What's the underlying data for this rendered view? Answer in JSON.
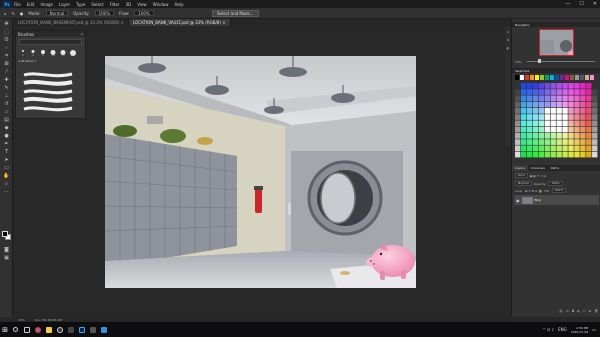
{
  "menubar": {
    "app_logo": "Ps",
    "items": [
      "File",
      "Edit",
      "Image",
      "Layer",
      "Type",
      "Select",
      "Filter",
      "3D",
      "View",
      "Window",
      "Help"
    ]
  },
  "window_controls": {
    "minimize": "—",
    "maximize": "☐",
    "close": "✕"
  },
  "options_bar": {
    "mode_label": "Mode:",
    "mode_value": "Normal",
    "opacity_label": "Opacity:",
    "opacity_value": "100%",
    "flow_label": "Flow:",
    "flow_value": "100%",
    "button_label": "Select and Mask..."
  },
  "tabs": [
    {
      "label": "LOCATION_BANK_BASEMENT.psd @ 33.3% (RGB/8) ×",
      "active": false
    },
    {
      "label": "LOCATION_BANK_VAULT.psd @ 33% (RGB/8) ×",
      "active": true
    }
  ],
  "brush_panel": {
    "title": "Brushes",
    "search_placeholder": "",
    "presets": [
      {
        "num": "1"
      },
      {
        "num": "3"
      },
      {
        "num": "5"
      },
      {
        "num": "10"
      },
      {
        "num": "30"
      },
      {
        "num": "50"
      }
    ],
    "group_label": "▸ Brushes 1"
  },
  "right_panels": {
    "navigator_tab": "Navigator",
    "zoom_value": "33%",
    "swatches_tab": "Swatches",
    "layers_tabs": [
      "Layers",
      "Channels",
      "Paths"
    ],
    "kind_label": "Kind",
    "blend_value": "Normal",
    "opacity_label": "Opacity:",
    "opacity_value": "100%",
    "lock_label": "Lock:",
    "fill_label": "Fill:",
    "fill_value": "100%",
    "layer_name": "Bkgr"
  },
  "status_bar": {
    "zoom": "33%",
    "doc": "Doc: 38.1M/38.1M"
  },
  "taskbar": {
    "lang": "ENG",
    "time": "2:56 PM",
    "date": "2020-07-28"
  },
  "colors": {
    "ps_blue": "#31a8ff",
    "wall": "#c9c9b8",
    "ceiling": "#d4d5d8",
    "vault_steel": "#8c8f95",
    "pig_pink": "#f2a6c0"
  }
}
